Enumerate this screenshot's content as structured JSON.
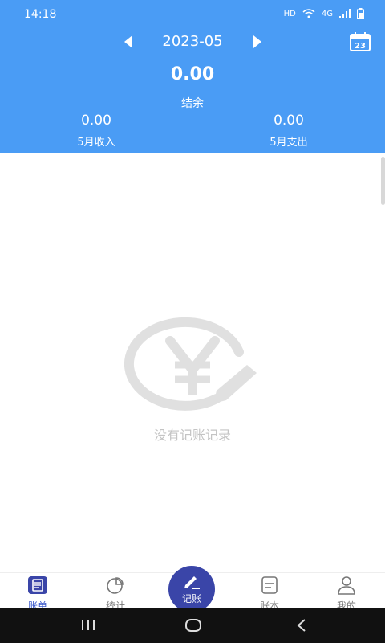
{
  "status_bar": {
    "time": "14:18",
    "hd": "HD",
    "network": "4G"
  },
  "header": {
    "month": "2023-05",
    "calendar_day": "23",
    "balance_value": "0.00",
    "balance_label": "结余",
    "income_value": "0.00",
    "income_label": "5月收入",
    "expense_value": "0.00",
    "expense_label": "5月支出"
  },
  "empty_state": {
    "text": "没有记账记录"
  },
  "tabbar": {
    "items": [
      {
        "label": "账单",
        "icon": "bill-icon",
        "active": true
      },
      {
        "label": "统计",
        "icon": "pie-chart-icon",
        "active": false
      },
      {
        "label": "记账",
        "icon": "edit-icon",
        "active": false
      },
      {
        "label": "账本",
        "icon": "ledger-icon",
        "active": false
      },
      {
        "label": "我的",
        "icon": "user-icon",
        "active": false
      }
    ]
  },
  "colors": {
    "header_bg": "#4a9cf5",
    "accent": "#3a45a8",
    "active_tab": "#3a58c9"
  }
}
